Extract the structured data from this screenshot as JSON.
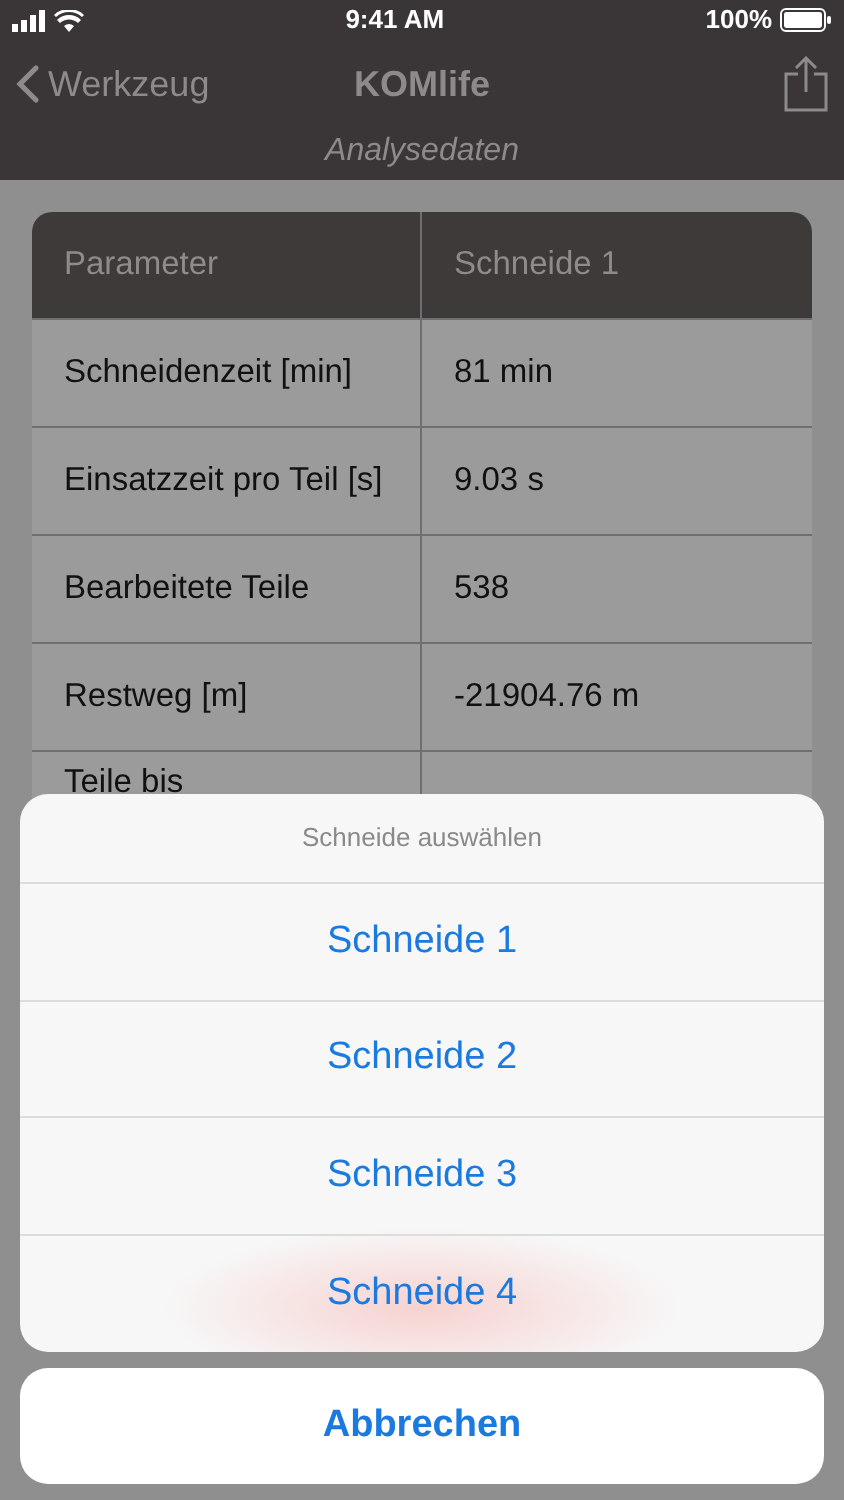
{
  "status_bar": {
    "time": "9:41 AM",
    "battery": "100%"
  },
  "nav": {
    "back": "Werkzeug",
    "title": "KOMlife",
    "subtitle": "Analysedaten"
  },
  "table": {
    "columns": [
      "Parameter",
      "Schneide 1"
    ],
    "rows": [
      [
        "Schneidenzeit [min]",
        "81 min"
      ],
      [
        "Einsatzzeit pro Teil [s]",
        "9.03 s"
      ],
      [
        "Bearbeitete Teile",
        "538"
      ],
      [
        "Restweg [m]",
        "-21904.76 m"
      ],
      [
        "Teile bis",
        ""
      ]
    ]
  },
  "action_sheet": {
    "title": "Schneide auswählen",
    "options": [
      "Schneide 1",
      "Schneide 2",
      "Schneide 3",
      "Schneide 4"
    ],
    "cancel": "Abbrechen"
  }
}
